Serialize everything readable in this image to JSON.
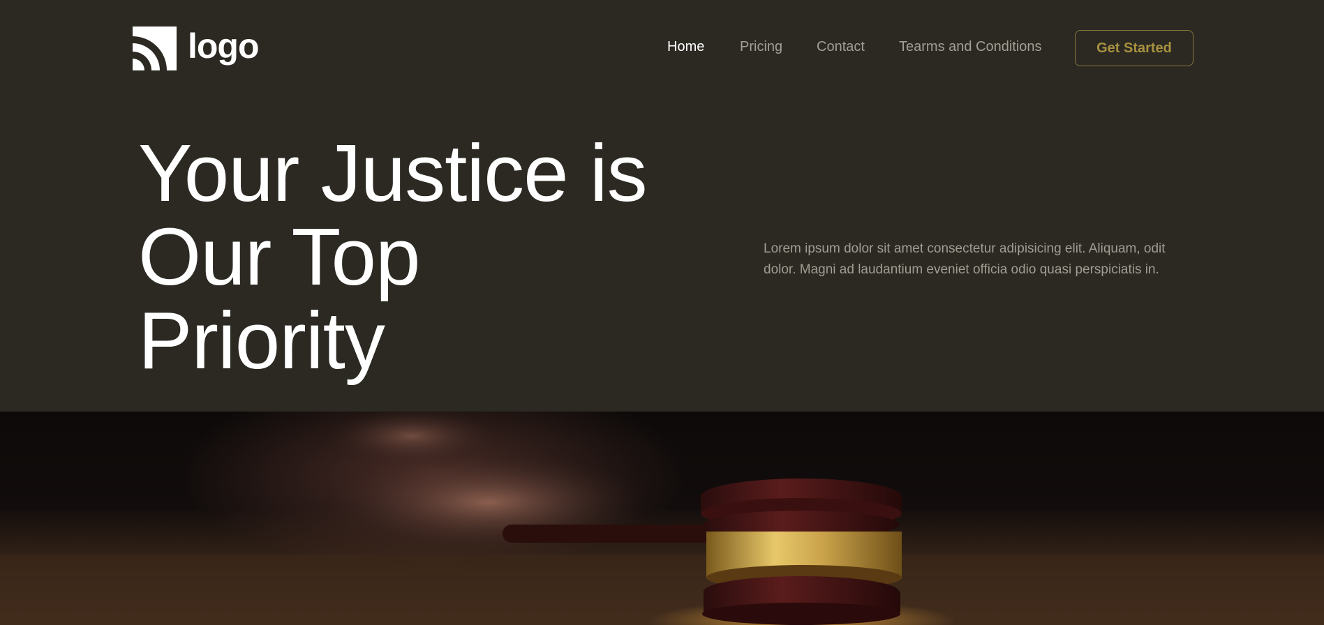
{
  "header": {
    "logo_text": "logo",
    "nav": [
      {
        "label": "Home",
        "active": true
      },
      {
        "label": "Pricing",
        "active": false
      },
      {
        "label": "Contact",
        "active": false
      },
      {
        "label": "Tearms and Conditions",
        "active": false
      }
    ],
    "cta_label": "Get Started"
  },
  "hero": {
    "title_lines": [
      "Your Justice is",
      "Our Top",
      "Priority"
    ],
    "description": "Lorem ipsum dolor sit amet consectetur adipisicing elit. Aliquam, odit dolor. Magni ad laudantium eveniet officia odio quasi perspiciatis in."
  },
  "colors": {
    "background": "#2b2922",
    "accent": "#a8923f",
    "text_primary": "#ffffff",
    "text_muted": "#a19d93"
  },
  "icons": {
    "logo": "signal-arcs-icon"
  }
}
